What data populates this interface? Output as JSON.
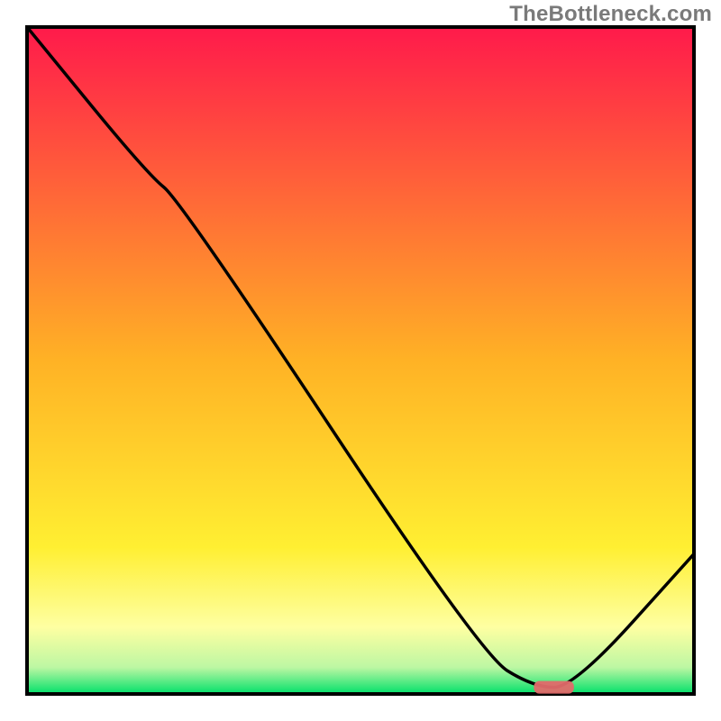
{
  "watermark": {
    "text": "TheBottleneck.com"
  },
  "chart_data": {
    "type": "line",
    "title": "",
    "xlabel": "",
    "ylabel": "",
    "xlim": [
      0,
      100
    ],
    "ylim": [
      0,
      100
    ],
    "grid": false,
    "legend": false,
    "series": [
      {
        "name": "curve",
        "x": [
          0,
          18,
          23,
          68,
          76,
          82,
          100
        ],
        "values": [
          100,
          78,
          74,
          6,
          1,
          1,
          21
        ]
      }
    ],
    "marker": {
      "x_range": [
        76,
        82
      ],
      "y": 1
    },
    "background": {
      "gradient": [
        {
          "stop": 0.0,
          "color": "#ff1a4b"
        },
        {
          "stop": 0.5,
          "color": "#ffb225"
        },
        {
          "stop": 0.78,
          "color": "#ffef32"
        },
        {
          "stop": 0.9,
          "color": "#feffa2"
        },
        {
          "stop": 0.96,
          "color": "#bdf7a3"
        },
        {
          "stop": 1.0,
          "color": "#00e06a"
        }
      ]
    }
  }
}
